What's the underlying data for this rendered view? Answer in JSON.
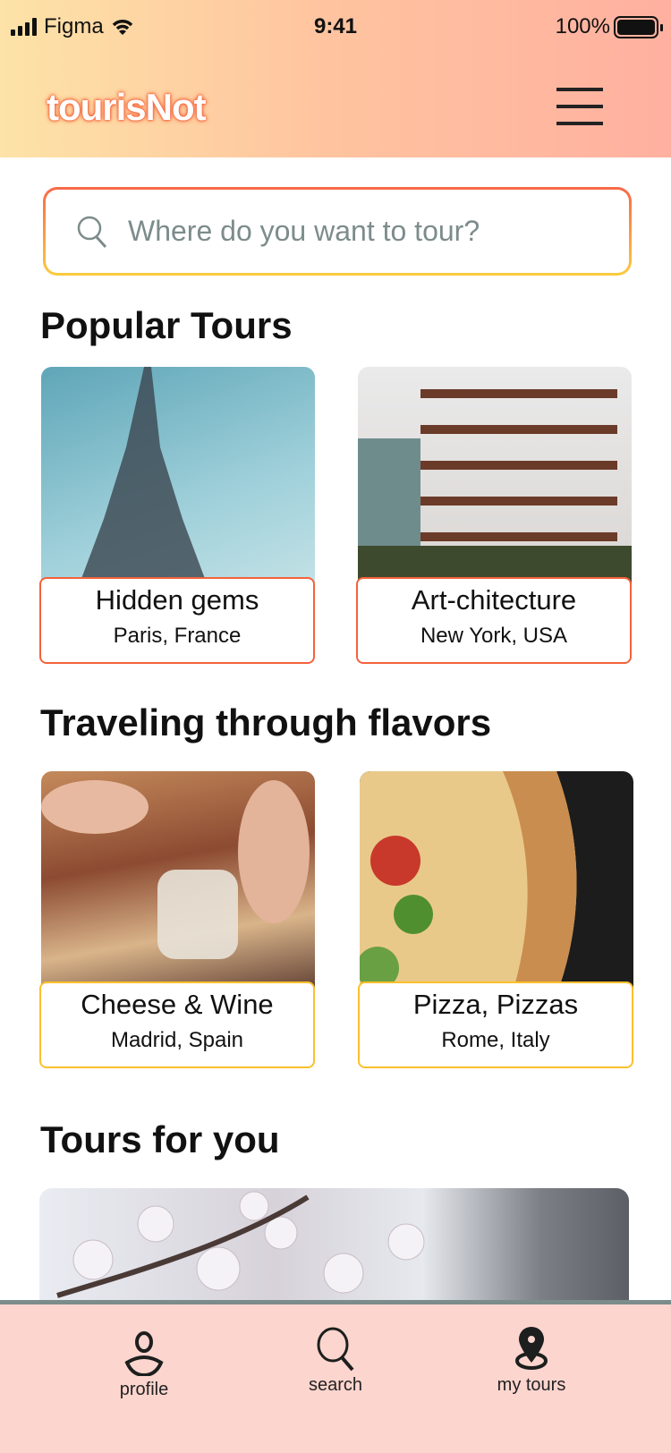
{
  "status_bar": {
    "carrier": "Figma",
    "time": "9:41",
    "battery": "100%"
  },
  "header": {
    "logo": "tourisNot"
  },
  "search": {
    "placeholder": "Where do you want to tour?"
  },
  "sections": [
    {
      "title": "Popular Tours",
      "cards": [
        {
          "title": "Hidden gems",
          "location": "Paris, France"
        },
        {
          "title": "Art-chitecture",
          "location": "New York, USA"
        }
      ]
    },
    {
      "title": "Traveling through flavors",
      "cards": [
        {
          "title": "Cheese & Wine",
          "location": "Madrid, Spain"
        },
        {
          "title": "Pizza, Pizzas",
          "location": "Rome, Italy"
        }
      ]
    },
    {
      "title": "Tours for you"
    }
  ],
  "bottom_nav": [
    {
      "label": "profile"
    },
    {
      "label": "search"
    },
    {
      "label": "my tours"
    }
  ],
  "colors": {
    "accent": "#f4623a",
    "secondary": "#fbc02d",
    "nav_bg": "#fcd5ce"
  }
}
